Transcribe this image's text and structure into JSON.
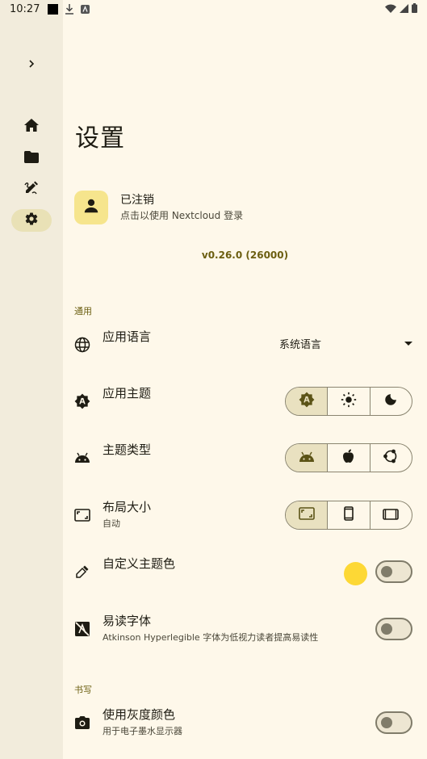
{
  "status_bar": {
    "time": "10:27"
  },
  "page": {
    "title": "设置"
  },
  "account": {
    "title": "已注销",
    "subtitle": "点击以使用 Nextcloud 登录"
  },
  "version": "v0.26.0 (26000)",
  "sections": {
    "general": "通用",
    "writing": "书写"
  },
  "settings": {
    "language": {
      "title": "应用语言",
      "value": "系统语言"
    },
    "app_theme": {
      "title": "应用主题",
      "options": [
        "auto-theme-icon",
        "light-mode-icon",
        "dark-mode-icon"
      ],
      "selected": 0
    },
    "theme_type": {
      "title": "主题类型",
      "options": [
        "android-icon",
        "apple-icon",
        "ubuntu-icon"
      ],
      "selected": 0
    },
    "layout_size": {
      "title": "布局大小",
      "subtitle": "自动",
      "options": [
        "fit-screen-icon",
        "phone-icon",
        "tablet-icon"
      ],
      "selected": 0
    },
    "custom_color": {
      "title": "自定义主题色",
      "color": "#fdd835",
      "enabled": false
    },
    "readable_font": {
      "title": "易读字体",
      "subtitle": "Atkinson Hyperlegible 字体为低视力读者提高易读性",
      "enabled": false
    },
    "grayscale": {
      "title": "使用灰度颜色",
      "subtitle": "用于电子墨水显示器",
      "enabled": false
    }
  },
  "colors": {
    "accent": "#6b5e10",
    "rail_active": "#e9e1b6",
    "background": "#fef8ea"
  }
}
